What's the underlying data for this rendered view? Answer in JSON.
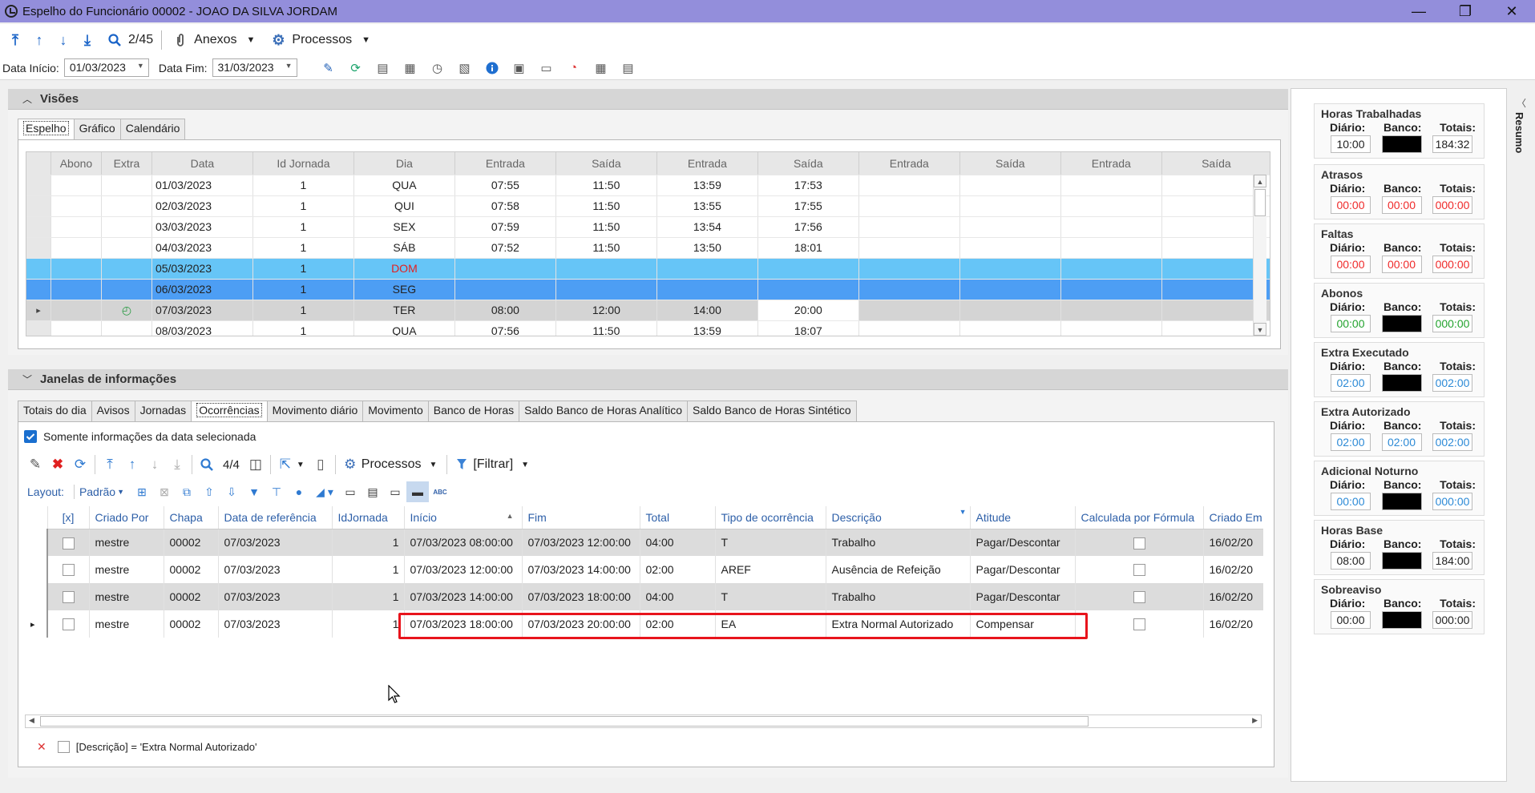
{
  "window": {
    "title": "Espelho do Funcionário 00002 - JOAO DA SILVA JORDAM",
    "minimize": "—",
    "maximize": "❐",
    "close": "✕"
  },
  "toolbar": {
    "position": "2/45",
    "anexos": "Anexos",
    "processos": "Processos"
  },
  "dates": {
    "inicio_label": "Data Início:",
    "inicio_value": "01/03/2023",
    "fim_label": "Data Fim:",
    "fim_value": "31/03/2023"
  },
  "visoes": {
    "title": "Visões",
    "tabs": [
      "Espelho",
      "Gráfico",
      "Calendário"
    ],
    "headers": [
      "Abono",
      "Extra",
      "Data",
      "Id Jornada",
      "Dia",
      "Entrada",
      "Saída",
      "Entrada",
      "Saída",
      "Entrada",
      "Saída",
      "Entrada",
      "Saída"
    ],
    "rows": [
      [
        "",
        "",
        "01/03/2023",
        "1",
        "QUA",
        "07:55",
        "11:50",
        "13:59",
        "17:53",
        "",
        "",
        "",
        ""
      ],
      [
        "",
        "",
        "02/03/2023",
        "1",
        "QUI",
        "07:58",
        "11:50",
        "13:55",
        "17:55",
        "",
        "",
        "",
        ""
      ],
      [
        "",
        "",
        "03/03/2023",
        "1",
        "SEX",
        "07:59",
        "11:50",
        "13:54",
        "17:56",
        "",
        "",
        "",
        ""
      ],
      [
        "",
        "",
        "04/03/2023",
        "1",
        "SÁB",
        "07:52",
        "11:50",
        "13:50",
        "18:01",
        "",
        "",
        "",
        ""
      ],
      [
        "",
        "",
        "05/03/2023",
        "1",
        "DOM",
        "",
        "",
        "",
        "",
        "",
        "",
        "",
        ""
      ],
      [
        "",
        "",
        "06/03/2023",
        "1",
        "SEG",
        "",
        "",
        "",
        "",
        "",
        "",
        "",
        ""
      ],
      [
        "",
        "",
        "07/03/2023",
        "1",
        "TER",
        "08:00",
        "12:00",
        "14:00",
        "20:00",
        "",
        "",
        "",
        ""
      ],
      [
        "",
        "",
        "08/03/2023",
        "1",
        "QUA",
        "07:56",
        "11:50",
        "13:59",
        "18:07",
        "",
        "",
        "",
        ""
      ]
    ]
  },
  "janelas": {
    "title": "Janelas de informações",
    "tabs": [
      "Totais do dia",
      "Avisos",
      "Jornadas",
      "Ocorrências",
      "Movimento diário",
      "Movimento",
      "Banco de Horas",
      "Saldo Banco de Horas Analítico",
      "Saldo Banco de Horas Sintético"
    ],
    "somente_label": "Somente informações da data selecionada",
    "count": "4/4",
    "processos": "Processos",
    "filtrar": "[Filtrar]",
    "layout_label": "Layout:",
    "layout_value": "Padrão",
    "abc": "ABC",
    "headers": [
      "[x]",
      "Criado Por",
      "Chapa",
      "Data de referência",
      "IdJornada",
      "Início",
      "Fim",
      "Total",
      "Tipo de ocorrência",
      "Descrição",
      "Atitude",
      "Calculada por Fórmula",
      "Criado Em"
    ],
    "rows": [
      [
        "mestre",
        "00002",
        "07/03/2023",
        "1",
        "07/03/2023 08:00:00",
        "07/03/2023 12:00:00",
        "04:00",
        "T",
        "Trabalho",
        "Pagar/Descontar",
        "16/02/20"
      ],
      [
        "mestre",
        "00002",
        "07/03/2023",
        "1",
        "07/03/2023 12:00:00",
        "07/03/2023 14:00:00",
        "02:00",
        "AREF",
        "Ausência de Refeição",
        "Pagar/Descontar",
        "16/02/20"
      ],
      [
        "mestre",
        "00002",
        "07/03/2023",
        "1",
        "07/03/2023 14:00:00",
        "07/03/2023 18:00:00",
        "04:00",
        "T",
        "Trabalho",
        "Pagar/Descontar",
        "16/02/20"
      ],
      [
        "mestre",
        "00002",
        "07/03/2023",
        "1",
        "07/03/2023 18:00:00",
        "07/03/2023 20:00:00",
        "02:00",
        "EA",
        "Extra Normal Autorizado",
        "Compensar",
        "16/02/20"
      ]
    ],
    "filter_text": "[Descrição] = 'Extra Normal Autorizado'"
  },
  "resumo": {
    "tab_label": "Resumo",
    "col_labels": [
      "Diário:",
      "Banco:",
      "Totais:"
    ],
    "boxes": [
      {
        "title": "Horas Trabalhadas",
        "diario": "10:00",
        "banco": "",
        "totais": "184:32",
        "color": "",
        "banco_black": true
      },
      {
        "title": "Atrasos",
        "diario": "00:00",
        "banco": "00:00",
        "totais": "000:00",
        "color": "r",
        "banco_black": false
      },
      {
        "title": "Faltas",
        "diario": "00:00",
        "banco": "00:00",
        "totais": "000:00",
        "color": "r",
        "banco_black": false
      },
      {
        "title": "Abonos",
        "diario": "00:00",
        "banco": "",
        "totais": "000:00",
        "color": "g",
        "banco_black": true
      },
      {
        "title": "Extra Executado",
        "diario": "02:00",
        "banco": "",
        "totais": "002:00",
        "color": "b",
        "banco_black": true
      },
      {
        "title": "Extra Autorizado",
        "diario": "02:00",
        "banco": "02:00",
        "totais": "002:00",
        "color": "b",
        "banco_black": false
      },
      {
        "title": "Adicional Noturno",
        "diario": "00:00",
        "banco": "",
        "totais": "000:00",
        "color": "b",
        "banco_black": true
      },
      {
        "title": "Horas Base",
        "diario": "08:00",
        "banco": "",
        "totais": "184:00",
        "color": "",
        "banco_black": true
      },
      {
        "title": "Sobreaviso",
        "diario": "00:00",
        "banco": "",
        "totais": "000:00",
        "color": "",
        "banco_black": true
      }
    ]
  }
}
